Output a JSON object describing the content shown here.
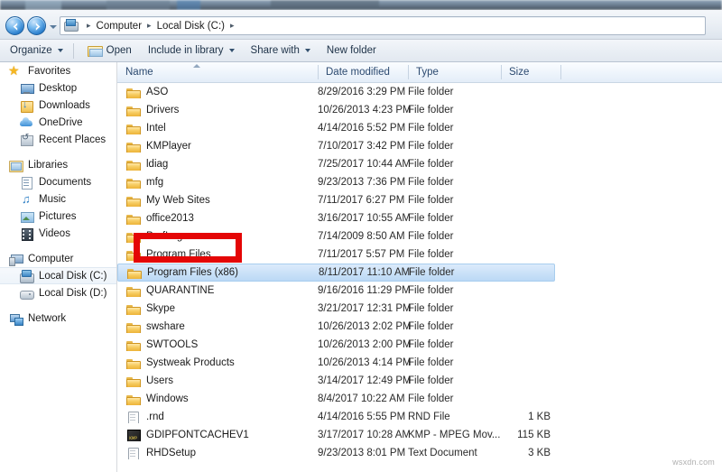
{
  "window": {
    "title_strip_visible": true
  },
  "address_bar": {
    "back_icon": "back-arrow-icon",
    "forward_icon": "forward-arrow-icon",
    "history_dropdown_icon": "chevron-down-icon",
    "location_icon": "computer-drive-icon",
    "breadcrumb": [
      "Computer",
      "Local Disk (C:)"
    ],
    "separator": "▸"
  },
  "toolbar": {
    "organize_label": "Organize",
    "open_label": "Open",
    "open_icon": "open-folder-icon",
    "include_label": "Include in library",
    "share_label": "Share with",
    "newfolder_label": "New folder"
  },
  "navigation_pane": {
    "groups": [
      {
        "header": {
          "label": "Favorites",
          "icon": "star-icon"
        },
        "items": [
          {
            "label": "Desktop",
            "icon": "desktop-icon"
          },
          {
            "label": "Downloads",
            "icon": "downloads-icon"
          },
          {
            "label": "OneDrive",
            "icon": "cloud-icon"
          },
          {
            "label": "Recent Places",
            "icon": "recent-places-icon"
          }
        ]
      },
      {
        "header": {
          "label": "Libraries",
          "icon": "library-icon"
        },
        "items": [
          {
            "label": "Documents",
            "icon": "documents-icon"
          },
          {
            "label": "Music",
            "icon": "music-icon"
          },
          {
            "label": "Pictures",
            "icon": "pictures-icon"
          },
          {
            "label": "Videos",
            "icon": "videos-icon"
          }
        ]
      },
      {
        "header": {
          "label": "Computer",
          "icon": "computer-icon"
        },
        "items": [
          {
            "label": "Local Disk (C:)",
            "icon": "hard-drive-c-icon",
            "selected": true
          },
          {
            "label": "Local Disk (D:)",
            "icon": "hard-drive-icon",
            "selected": false
          }
        ]
      },
      {
        "header": {
          "label": "Network",
          "icon": "network-icon"
        },
        "items": []
      }
    ]
  },
  "file_list": {
    "columns": [
      {
        "label": "Name",
        "sorted": true
      },
      {
        "label": "Date modified",
        "sorted": false
      },
      {
        "label": "Type",
        "sorted": false
      },
      {
        "label": "Size",
        "sorted": false
      }
    ],
    "rows": [
      {
        "name": "ASO",
        "date": "8/29/2016 3:29 PM",
        "type": "File folder",
        "size": "",
        "icon": "folder-icon",
        "selected": false
      },
      {
        "name": "Drivers",
        "date": "10/26/2013 4:23 PM",
        "type": "File folder",
        "size": "",
        "icon": "folder-icon",
        "selected": false
      },
      {
        "name": "Intel",
        "date": "4/14/2016 5:52 PM",
        "type": "File folder",
        "size": "",
        "icon": "folder-icon",
        "selected": false
      },
      {
        "name": "KMPlayer",
        "date": "7/10/2017 3:42 PM",
        "type": "File folder",
        "size": "",
        "icon": "folder-icon",
        "selected": false
      },
      {
        "name": "ldiag",
        "date": "7/25/2017 10:44 AM",
        "type": "File folder",
        "size": "",
        "icon": "folder-icon",
        "selected": false
      },
      {
        "name": "mfg",
        "date": "9/23/2013 7:36 PM",
        "type": "File folder",
        "size": "",
        "icon": "folder-icon",
        "selected": false
      },
      {
        "name": "My Web Sites",
        "date": "7/11/2017 6:27 PM",
        "type": "File folder",
        "size": "",
        "icon": "folder-icon",
        "selected": false
      },
      {
        "name": "office2013",
        "date": "3/16/2017 10:55 AM",
        "type": "File folder",
        "size": "",
        "icon": "folder-icon",
        "selected": false
      },
      {
        "name": "PerfLogs",
        "date": "7/14/2009 8:50 AM",
        "type": "File folder",
        "size": "",
        "icon": "folder-icon",
        "selected": false
      },
      {
        "name": "Program Files",
        "date": "7/11/2017 5:57 PM",
        "type": "File folder",
        "size": "",
        "icon": "folder-icon",
        "selected": false
      },
      {
        "name": "Program Files (x86)",
        "date": "8/11/2017 11:10 AM",
        "type": "File folder",
        "size": "",
        "icon": "folder-icon",
        "selected": true
      },
      {
        "name": "QUARANTINE",
        "date": "9/16/2016 11:29 PM",
        "type": "File folder",
        "size": "",
        "icon": "folder-icon",
        "selected": false
      },
      {
        "name": "Skype",
        "date": "3/21/2017 12:31 PM",
        "type": "File folder",
        "size": "",
        "icon": "folder-icon",
        "selected": false
      },
      {
        "name": "swshare",
        "date": "10/26/2013 2:02 PM",
        "type": "File folder",
        "size": "",
        "icon": "folder-icon",
        "selected": false
      },
      {
        "name": "SWTOOLS",
        "date": "10/26/2013 2:00 PM",
        "type": "File folder",
        "size": "",
        "icon": "folder-icon",
        "selected": false
      },
      {
        "name": "Systweak Products",
        "date": "10/26/2013 4:14 PM",
        "type": "File folder",
        "size": "",
        "icon": "folder-icon",
        "selected": false
      },
      {
        "name": "Users",
        "date": "3/14/2017 12:49 PM",
        "type": "File folder",
        "size": "",
        "icon": "folder-icon",
        "selected": false
      },
      {
        "name": "Windows",
        "date": "8/4/2017 10:22 AM",
        "type": "File folder",
        "size": "",
        "icon": "folder-icon",
        "selected": false
      },
      {
        "name": ".rnd",
        "date": "4/14/2016 5:55 PM",
        "type": "RND File",
        "size": "1 KB",
        "icon": "generic-file-icon",
        "selected": false
      },
      {
        "name": "GDIPFONTCACHEV1",
        "date": "3/17/2017 10:28 AM",
        "type": "KMP - MPEG Mov...",
        "size": "115 KB",
        "icon": "media-file-icon",
        "selected": false
      },
      {
        "name": "RHDSetup",
        "date": "9/23/2013 8:01 PM",
        "type": "Text Document",
        "size": "3 KB",
        "icon": "text-file-icon",
        "selected": false
      }
    ]
  },
  "annotation": {
    "highlight_target": "Program Files (x86)",
    "color": "#e40606"
  },
  "watermark": {
    "text": "wsxdn.com"
  }
}
